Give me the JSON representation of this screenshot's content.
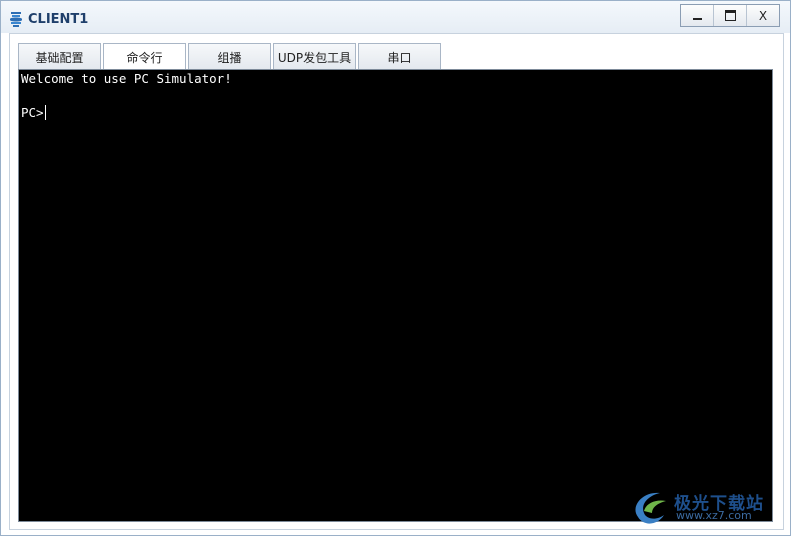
{
  "window": {
    "title": "CLIENT1",
    "buttons": {
      "minimize": "",
      "maximize": "",
      "close": "X"
    }
  },
  "tabs": [
    {
      "label": "基础配置",
      "active": false
    },
    {
      "label": "命令行",
      "active": true
    },
    {
      "label": "组播",
      "active": false
    },
    {
      "label": "UDP发包工具",
      "active": false
    },
    {
      "label": "串口",
      "active": false
    }
  ],
  "terminal": {
    "welcome": "Welcome to use PC Simulator!",
    "prompt": "PC>",
    "background": "#000000",
    "foreground": "#ffffff"
  },
  "watermark": {
    "brand": "极光下载站",
    "url": "www.xz7.com"
  },
  "colors": {
    "title_text": "#1f3f6b",
    "window_border": "#9ab0c8"
  }
}
